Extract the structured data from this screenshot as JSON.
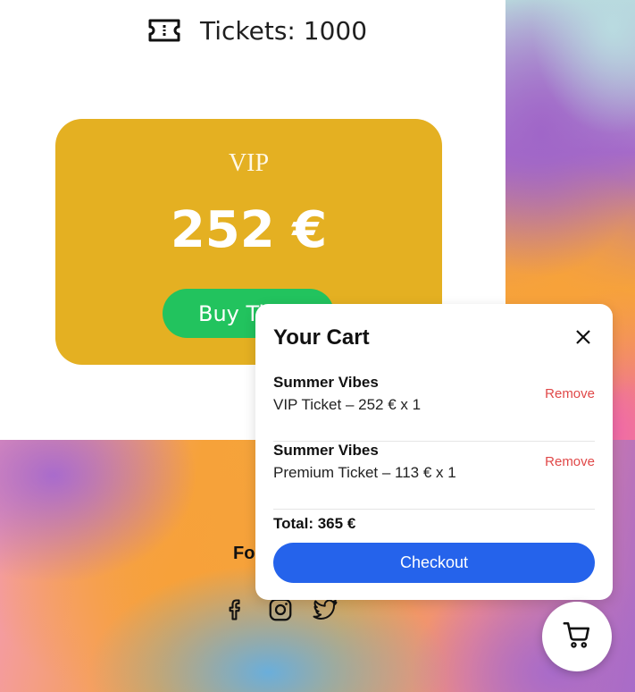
{
  "header": {
    "tickets_label": "Tickets: 1000",
    "ticket_icon": "ticket-icon"
  },
  "vip_card": {
    "title": "VIP",
    "price": "252 €",
    "buy_label": "Buy Tickets",
    "color": "#e4b022",
    "button_color": "#22c35e"
  },
  "footer": {
    "follow_label": "Follow Us",
    "social_icons": [
      "facebook-icon",
      "instagram-icon",
      "twitter-icon"
    ]
  },
  "cart": {
    "title": "Your Cart",
    "items": [
      {
        "event": "Summer Vibes",
        "detail": "VIP Ticket – 252 € x 1",
        "remove_label": "Remove"
      },
      {
        "event": "Summer Vibes",
        "detail": "Premium Ticket – 113 € x 1",
        "remove_label": "Remove"
      }
    ],
    "total": "Total: 365 €",
    "checkout_label": "Checkout",
    "checkout_color": "#2563eb",
    "remove_color": "#e04848"
  }
}
